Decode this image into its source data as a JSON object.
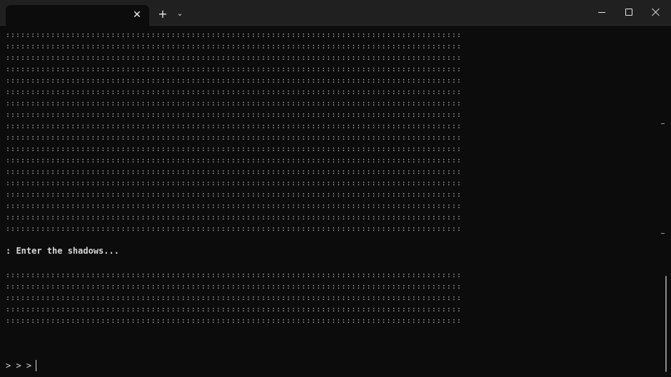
{
  "titlebar": {
    "tab_title": "",
    "tab_close": "✕",
    "new_tab": "+",
    "dropdown": "⌄"
  },
  "terminal": {
    "dot_row": ":::::::::::::::::::::::::::::::::::::::::::::::::::::::::::::::::::::::::::::::::::::::::::",
    "top_rows": 18,
    "bottom_rows": 5,
    "message": ": Enter the shadows...",
    "prompt": "> > >"
  },
  "colors": {
    "background": "#0c0c0c",
    "titlebar": "#202020",
    "text": "#cccccc"
  }
}
